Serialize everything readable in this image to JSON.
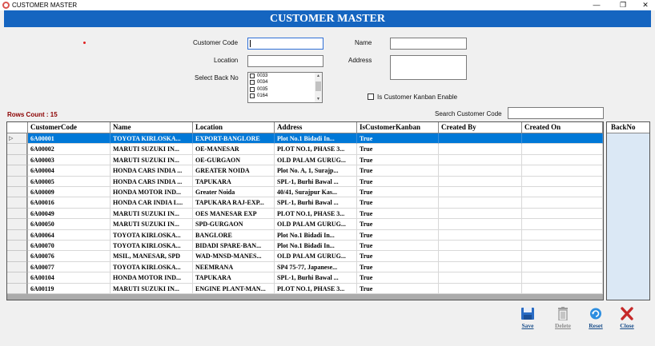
{
  "window": {
    "title": "CUSTOMER MASTER"
  },
  "header": {
    "title": "CUSTOMER MASTER"
  },
  "form": {
    "customer_code_label": "Customer Code",
    "customer_code_value": "",
    "name_label": "Name",
    "name_value": "",
    "location_label": "Location",
    "location_value": "",
    "address_label": "Address",
    "address_value": "",
    "back_no_label": "Select Back No",
    "back_no_options": [
      "0033",
      "0034",
      "0035",
      "0164"
    ],
    "kanban_label": "Is Customer Kanban Enable",
    "search_label": "Search Customer Code",
    "search_value": ""
  },
  "rows_count": "Rows Count : 15",
  "grid": {
    "columns": [
      "CustomerCode",
      "Name",
      "Location",
      "Address",
      "IsCustomerKanban",
      "Created By",
      "Created On"
    ],
    "rows": [
      [
        "6A00001",
        "TOYOTA KIRLOSKA...",
        "EXPORT-BANGLORE",
        "Plot No.1 Bidadi In...",
        "True",
        "",
        ""
      ],
      [
        "6A00002",
        "MARUTI SUZUKI IN...",
        "OE-MANESAR",
        "PLOT NO.1, PHASE 3...",
        "True",
        "",
        ""
      ],
      [
        "6A00003",
        "MARUTI SUZUKI IN...",
        "OE-GURGAON",
        "OLD PALAM GURUG...",
        "True",
        "",
        ""
      ],
      [
        "6A00004",
        "HONDA CARS INDIA ...",
        "GREATER NOIDA",
        "Plot No. A, 1, Surajp...",
        "True",
        "",
        ""
      ],
      [
        "6A00005",
        "HONDA CARS INDIA ...",
        "TAPUKARA",
        "SPL-1, Burhi Bawal ...",
        "True",
        "",
        ""
      ],
      [
        "6A00009",
        "HONDA MOTOR IND...",
        " Greater Noida",
        "40/41, Surajpur Kas...",
        "True",
        "",
        ""
      ],
      [
        "6A00016",
        "HONDA CAR INDIA L...",
        "TAPUKARA RAJ-EXP...",
        "SPL-1, Burhi Bawal ...",
        "True",
        "",
        ""
      ],
      [
        "6A00049",
        "MARUTI SUZUKI IN...",
        "OES MANESAR EXP",
        "PLOT NO.1, PHASE 3...",
        "True",
        "",
        ""
      ],
      [
        "6A00050",
        "MARUTI SUZUKI IN...",
        "SPD-GURGAON",
        "OLD PALAM GURUG...",
        "True",
        "",
        ""
      ],
      [
        "6A00064",
        "TOYOTA KIRLOSKA...",
        "BANGLORE",
        "Plot No.1 Bidadi In...",
        "True",
        "",
        ""
      ],
      [
        "6A00070",
        "TOYOTA KIRLOSKA...",
        "BIDADI SPARE-BAN...",
        "Plot No.1 Bidadi In...",
        "True",
        "",
        ""
      ],
      [
        "6A00076",
        "MSIL, MANESAR, SPD",
        "WAD-MNSD-MANES...",
        "OLD PALAM GURUG...",
        "True",
        "",
        ""
      ],
      [
        "6A00077",
        "TOYOTA KIRLOSKA...",
        "NEEMRANA",
        "SP4 75-77, Japanese...",
        "True",
        "",
        ""
      ],
      [
        "6A00104",
        "HONDA MOTOR IND...",
        "TAPUKARA",
        "SPL-1, Burhi Bawal ...",
        "True",
        "",
        ""
      ],
      [
        "6A00119",
        "MARUTI SUZUKI IN...",
        "ENGINE PLANT-MAN...",
        "PLOT NO.1, PHASE 3...",
        "True",
        "",
        ""
      ]
    ],
    "selected_row": 0
  },
  "backno_panel": {
    "header": "BackNo"
  },
  "toolbar": {
    "save": "Save",
    "delete": "Delete",
    "reset": "Reset",
    "close": "Close",
    "icons": {
      "save": "floppy-disk-icon",
      "delete": "trash-bin-icon",
      "reset": "refresh-icon",
      "close": "close-x-icon"
    }
  },
  "colors": {
    "banner": "#1565c0",
    "selection": "#0078d7",
    "rows_count": "#8b0000",
    "close_icon": "#c62828"
  }
}
